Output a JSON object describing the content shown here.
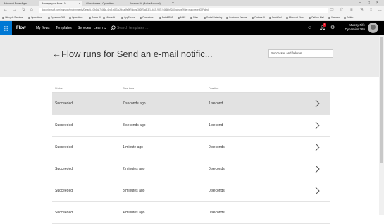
{
  "browser": {
    "tabs": [
      {
        "title": "Microsoft PowerApps",
        "active": false
      },
      {
        "title": "Manage your flows | M",
        "active": true
      },
      {
        "title": "All customers - Operations",
        "active": false
      },
      {
        "title": "Amanda Ma (Active Account)",
        "active": false
      }
    ],
    "url": "flow.microsoft.com/manage/environments/Default-10fb1da7-4b6e-4ed9-b8f3-c2fb1a8fe9f7/flows/3b2f71a5-3f1f-4e2f-9d7f-94b6bb92a0bc/runs?filter=succeededOrFailed",
    "favorites": [
      "Lifecycle Services",
      "Operations",
      "Dynamics 365",
      "Operations",
      "Power BI",
      "Microsoft",
      "AppSource",
      "Operations",
      "Retail POS",
      "MMS",
      "Sites",
      "Social Listening",
      "Customer Service",
      "Cortana BI",
      "SendGrid",
      "Microsoft Flow",
      "Outlook Mail",
      "Yammer",
      "Twitter"
    ]
  },
  "app": {
    "brand": "Flow",
    "nav": [
      "My flows",
      "Templates",
      "Services",
      "Learn ⌄"
    ],
    "search_placeholder": "Search templates ...",
    "notification_count": "1",
    "user_name": "Murray Fife",
    "user_org": "Dynamics 365"
  },
  "page": {
    "back": "←",
    "title": "Flow runs for Send an e-mail notific...",
    "filter_value": "Successes and failures"
  },
  "table": {
    "headers": {
      "status": "Status",
      "start": "Start time",
      "duration": "Duration"
    },
    "rows": [
      {
        "status": "Succeeded",
        "start": "7 seconds ago",
        "duration": "1 second",
        "selected": true
      },
      {
        "status": "Succeeded",
        "start": "8 seconds ago",
        "duration": "1 second",
        "selected": false
      },
      {
        "status": "Succeeded",
        "start": "1 minute ago",
        "duration": "0 seconds",
        "selected": false
      },
      {
        "status": "Succeeded",
        "start": "2 minutes ago",
        "duration": "0 seconds",
        "selected": false
      },
      {
        "status": "Succeeded",
        "start": "3 minutes ago",
        "duration": "0 seconds",
        "selected": false
      },
      {
        "status": "Succeeded",
        "start": "4 minutes ago",
        "duration": "0 seconds",
        "selected": false
      }
    ]
  },
  "colors": {
    "accent": "#0078d4",
    "header_bg": "#000000",
    "page_header_bg": "#eaeaea",
    "selected_row": "#e2e2e2"
  }
}
